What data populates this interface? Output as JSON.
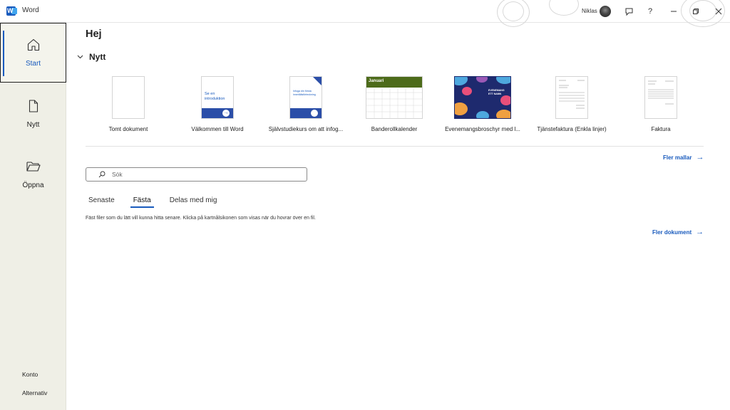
{
  "app": {
    "logo_letter": "W",
    "title": "Word"
  },
  "titlebar": {
    "user_name": "Niklas",
    "buttons": [
      "feedback-icon",
      "help-icon",
      "minimize-icon",
      "restore-icon",
      "close-icon"
    ],
    "help_glyph": "?"
  },
  "nav": {
    "items": [
      {
        "label": "Start",
        "icon": "home-icon"
      },
      {
        "label": "Nytt",
        "icon": "new-document-icon"
      },
      {
        "label": "Öppna",
        "icon": "folder-open-icon"
      }
    ],
    "bottom": [
      {
        "label": "Konto"
      },
      {
        "label": "Alternativ"
      }
    ]
  },
  "main": {
    "greeting": "Hej",
    "new_section": {
      "title": "Nytt"
    },
    "templates": [
      {
        "label": "Tomt dokument"
      },
      {
        "label": "Välkommen till Word",
        "thumb_text": "Se en introduktion"
      },
      {
        "label": "Självstudiekurs om att infog...",
        "thumb_text": "Infoga din första innehållsförteckning"
      },
      {
        "label": "Banderollkalender",
        "thumb_text": "Januari"
      },
      {
        "label": "Evenemangsbroschyr med l...",
        "thumb_text": "EVENEMANG ETT NAMN"
      },
      {
        "label": "Tjänstefaktura (Enkla linjer)"
      },
      {
        "label": "Faktura"
      }
    ],
    "more_templates": "Fler mallar",
    "search": {
      "placeholder": "Sök"
    },
    "tabs": [
      {
        "label": "Senaste"
      },
      {
        "label": "Fästa"
      },
      {
        "label": "Delas med mig"
      }
    ],
    "active_tab": "Fästa",
    "pinned_info": "Fäst filer som du lätt vill kunna hitta senare. Klicka på kartnålsikonen som visas när du hovrar över en fil.",
    "more_documents": "Fler dokument"
  },
  "colors": {
    "accent": "#185abd",
    "nav_bg": "#efefe6",
    "calendar_header": "#4d6b1a",
    "brochure_bg": "#1e2a6e"
  }
}
